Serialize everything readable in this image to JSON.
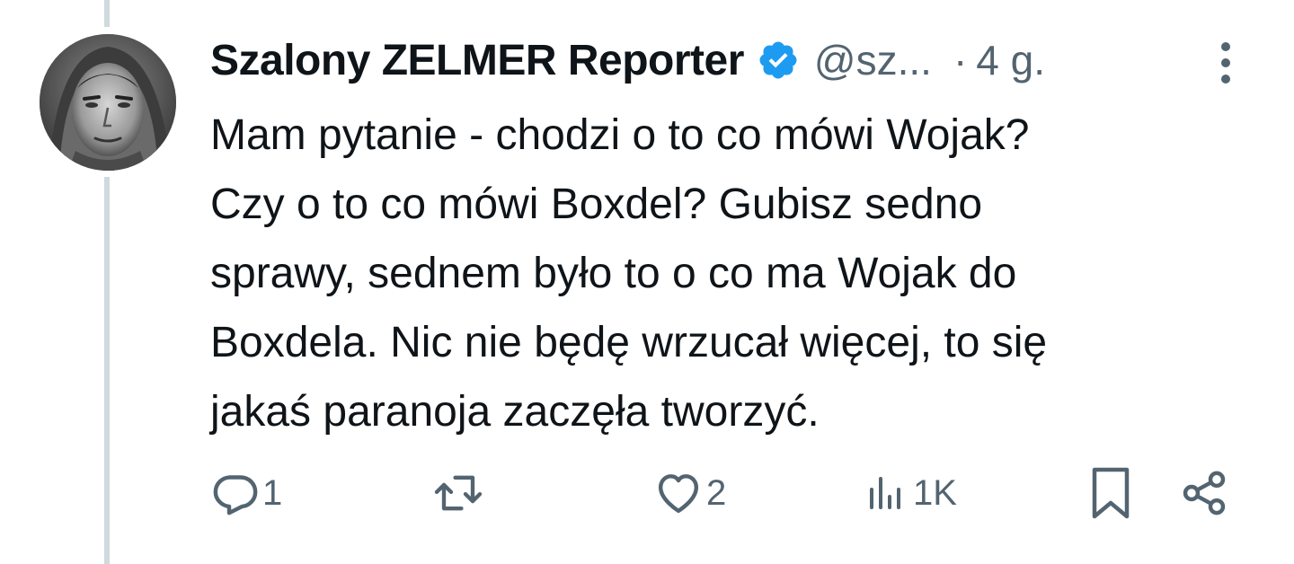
{
  "tweet": {
    "display_name": "Szalony ZELMER Reporter",
    "handle": "@sz...",
    "separator": "·",
    "time": "4 g.",
    "text_lines": [
      "Mam pytanie - chodzi o to co mówi Wojak?",
      "Czy o to co mówi Boxdel? Gubisz sedno",
      "sprawy, sednem było to o co ma Wojak do",
      "Boxdela. Nic nie będę wrzucał więcej, to się",
      "jakaś paranoja zaczęła tworzyć."
    ]
  },
  "actions": {
    "reply_count": "1",
    "repost_count": "",
    "like_count": "2",
    "views_count": "1K"
  },
  "icons": {
    "verified": "verified-badge-icon",
    "more": "more-vertical-icon",
    "reply": "reply-icon",
    "repost": "repost-icon",
    "like": "heart-icon",
    "views": "views-bar-icon",
    "bookmark": "bookmark-icon",
    "share": "share-icon"
  },
  "colors": {
    "verified_blue": "#1d9bf0",
    "muted": "#536471",
    "text": "#0f1419",
    "thread_line": "#cfd9de"
  }
}
